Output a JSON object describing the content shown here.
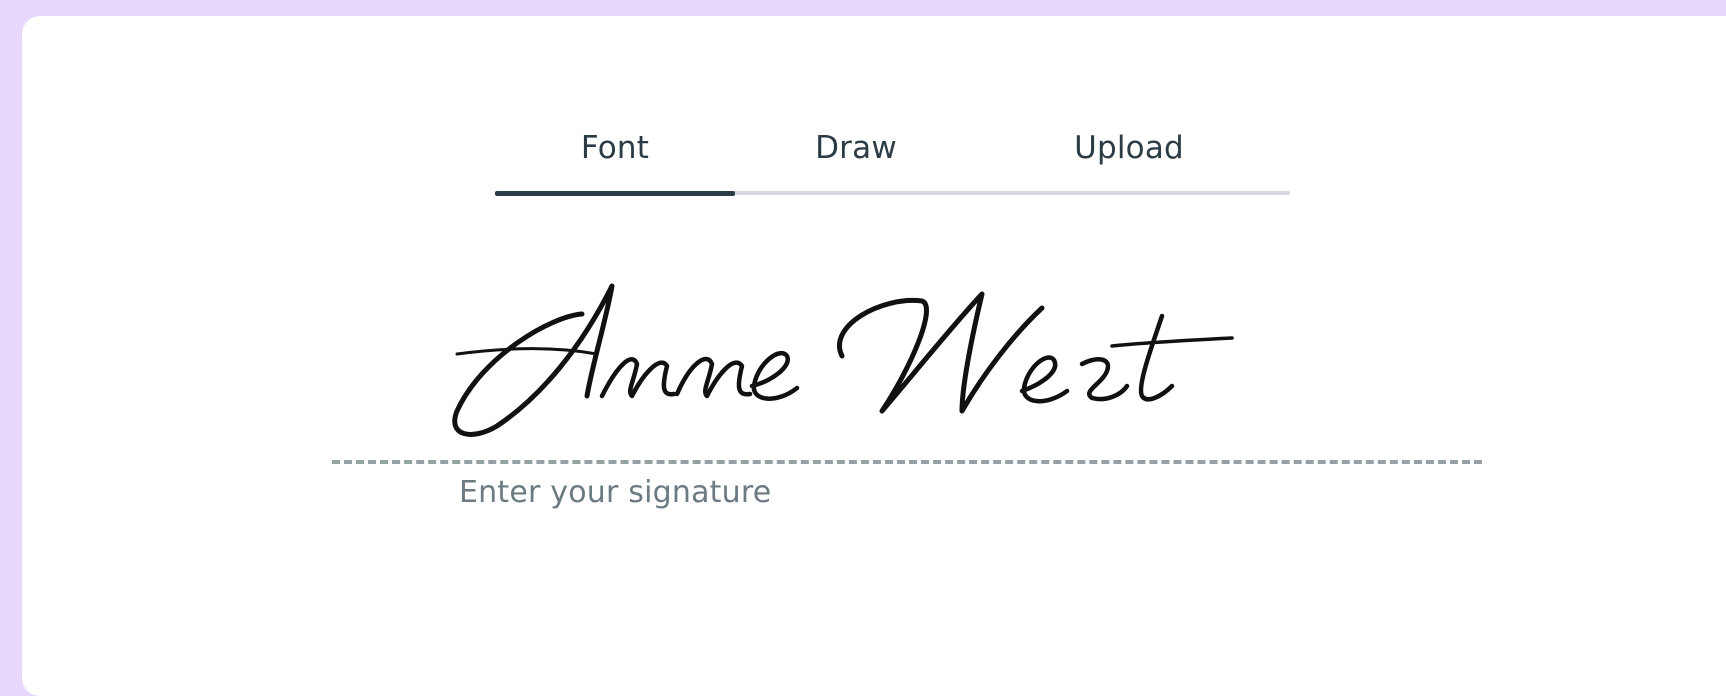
{
  "tabs": {
    "font_label": "Font",
    "draw_label": "Draw",
    "upload_label": "Upload",
    "active": "Font"
  },
  "signature": {
    "value": "Anne West",
    "placeholder": "Enter your signature"
  },
  "colors": {
    "background": "#e6d7fb",
    "card": "#ffffff",
    "tab_text": "#2b3c46",
    "tab_indicator": "#2b3c46",
    "tab_track": "#d9d8de",
    "baseline": "#96a1a5",
    "label": "#6b7b82",
    "ink": "#111111"
  }
}
